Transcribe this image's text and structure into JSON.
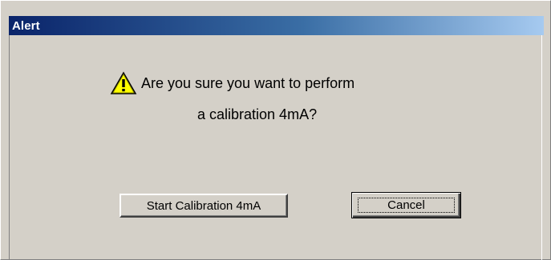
{
  "window": {
    "title": "Alert"
  },
  "message": {
    "icon": "warning-icon",
    "line1": "Are you sure you want to perform",
    "line2": "a calibration 4mA?"
  },
  "buttons": {
    "start_label": "Start Calibration 4mA",
    "cancel_label": "Cancel"
  },
  "colors": {
    "face": "#d4d0c8",
    "title_start": "#0a246a",
    "title_end": "#a6caf0",
    "warning": "#ffff00"
  }
}
